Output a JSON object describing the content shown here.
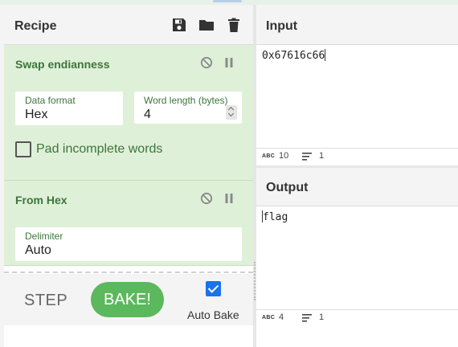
{
  "colors": {
    "recipe_op_bg": "#dff0d8",
    "recipe_op_text": "#3c763d",
    "bake_button": "#5cb85c",
    "checkbox_checked": "#1a73e8"
  },
  "recipe": {
    "title": "Recipe",
    "icons": [
      "save-icon",
      "folder-open-icon",
      "trash-icon"
    ],
    "operations": [
      {
        "name": "Swap endianness",
        "controls": [
          "disable-icon",
          "pause-icon"
        ],
        "fields": [
          {
            "label": "Data format",
            "value": "Hex"
          },
          {
            "label": "Word length (bytes)",
            "value": "4"
          }
        ],
        "checkbox": {
          "label": "Pad incomplete words",
          "checked": false
        }
      },
      {
        "name": "From Hex",
        "controls": [
          "disable-icon",
          "pause-icon"
        ],
        "fields": [
          {
            "label": "Delimiter",
            "value": "Auto"
          }
        ]
      }
    ]
  },
  "controls": {
    "step_label": "STEP",
    "bake_label": "BAKE!",
    "auto_bake_label": "Auto Bake",
    "auto_bake_checked": true
  },
  "input": {
    "title": "Input",
    "text": "0x67616c66",
    "status": {
      "abc_label": "ABC",
      "length": "10",
      "lines": "1"
    }
  },
  "output": {
    "title": "Output",
    "text": "flag",
    "status": {
      "abc_label": "ABC",
      "length": "4",
      "lines": "1"
    }
  }
}
